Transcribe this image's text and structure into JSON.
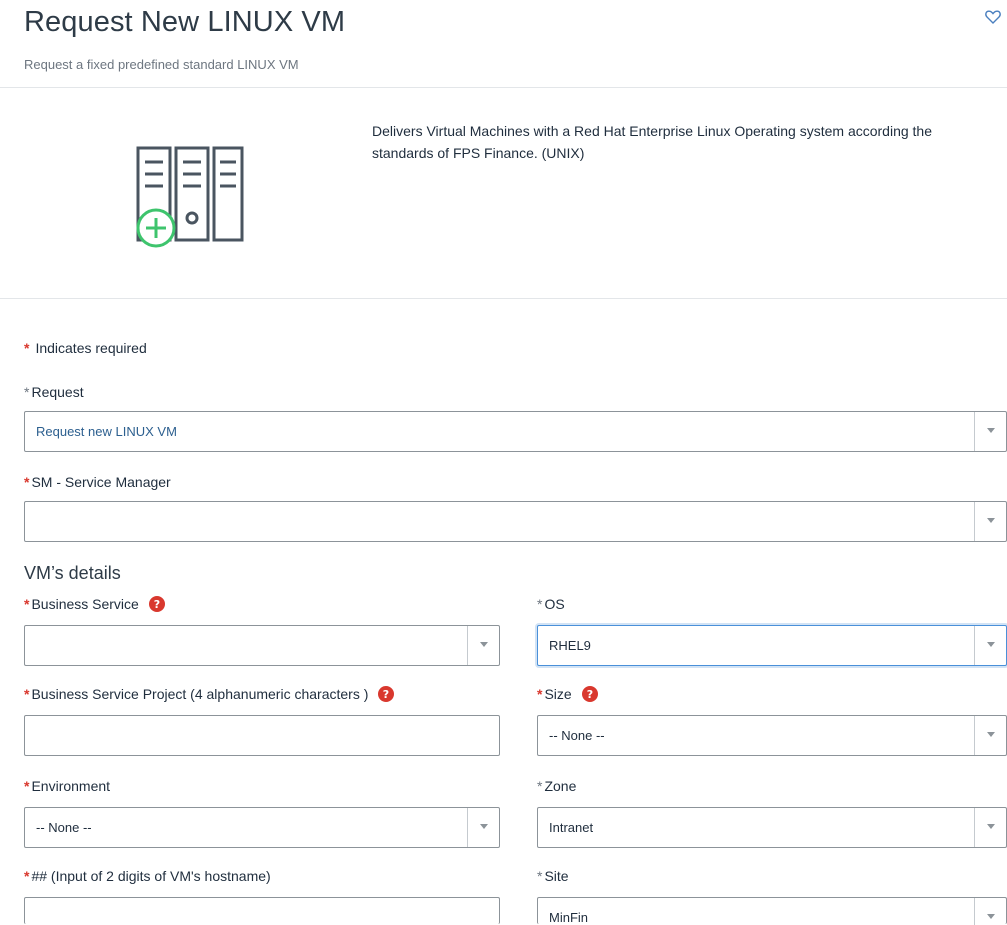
{
  "header": {
    "title": "Request New LINUX VM",
    "subtitle": "Request a fixed predefined standard LINUX VM"
  },
  "info": {
    "description": "Delivers Virtual Machines with a Red Hat Enterprise Linux Operating system according the standards of FPS Finance. (UNIX)",
    "icon": "server-add-icon"
  },
  "form": {
    "required_note": "Indicates required",
    "required_marker": "*",
    "request": {
      "label": "Request",
      "value": "Request new LINUX VM"
    },
    "service_manager": {
      "label": "SM - Service Manager",
      "value": ""
    },
    "section_title": "VM’s details",
    "business_service": {
      "label": "Business Service",
      "value": ""
    },
    "os": {
      "label": "OS",
      "value": "RHEL9"
    },
    "business_service_project": {
      "label": "Business Service Project (4 alphanumeric characters )",
      "value": ""
    },
    "size": {
      "label": "Size",
      "value": "-- None --"
    },
    "environment": {
      "label": "Environment",
      "value": "-- None --"
    },
    "zone": {
      "label": "Zone",
      "value": "Intranet"
    },
    "hostname_digits": {
      "label": "## (Input of 2 digits of VM's hostname)",
      "value": ""
    },
    "site": {
      "label": "Site",
      "value": "MinFin"
    }
  },
  "colors": {
    "required": "#d9382e",
    "link": "#2c5f8f",
    "icon_green": "#3ec46d",
    "icon_grey": "#4a5560",
    "focus": "#4a90d9"
  }
}
